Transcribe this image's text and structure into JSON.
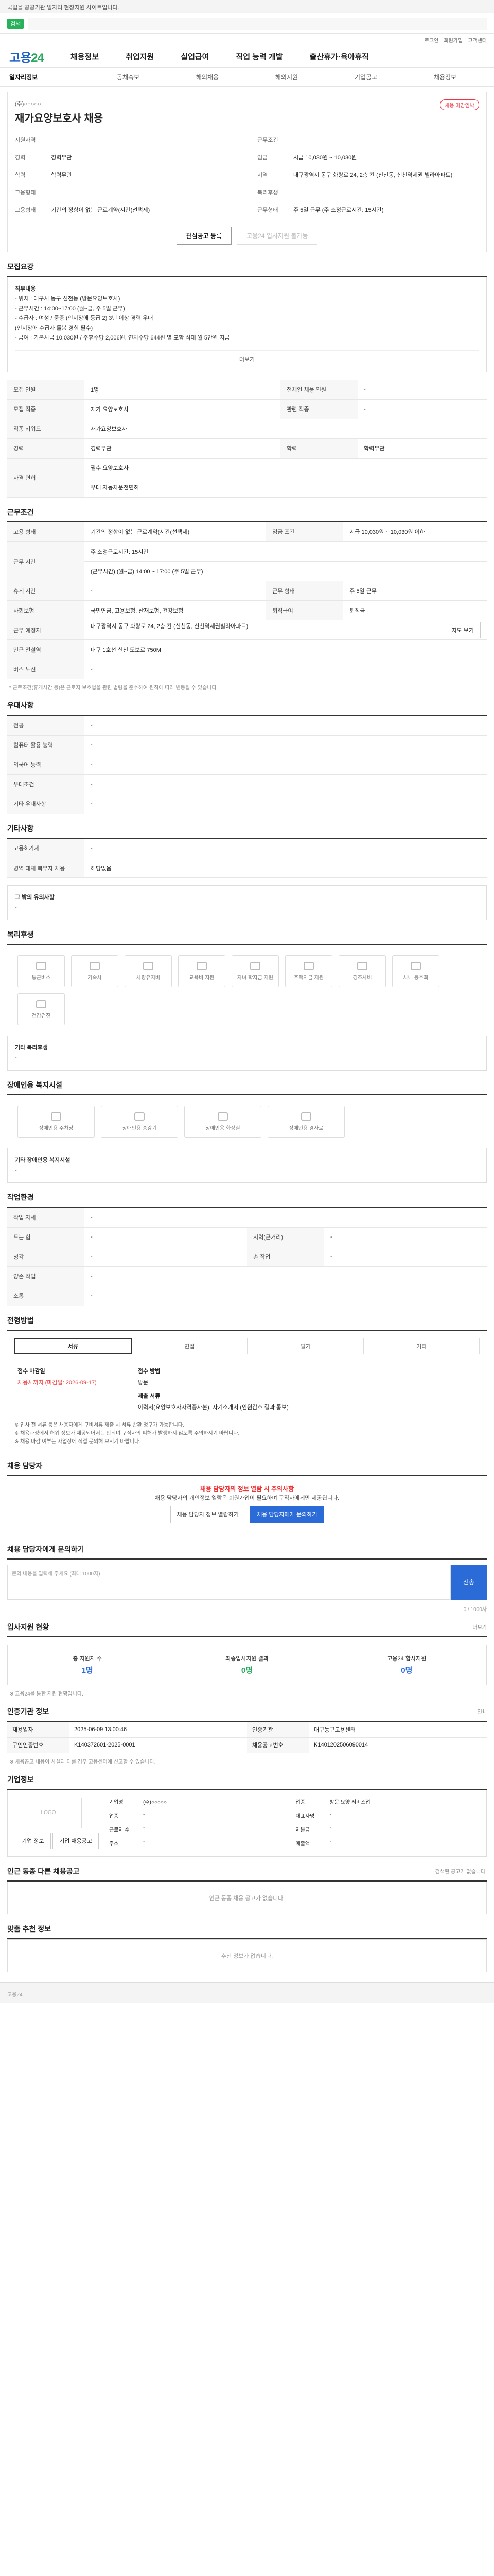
{
  "top": {
    "notice": "국립을 공공기관 일자리 현장지원 사이트입니다."
  },
  "search": {
    "badge": "검색",
    "placeholder": ""
  },
  "util": [
    "로그인",
    "회원가입",
    "고객센터"
  ],
  "gnb": {
    "logo_main": "고용",
    "logo_sub": "24",
    "menus": [
      "채용정보",
      "취업지원",
      "실업급여",
      "직업 능력 개발",
      "출산휴가·육아휴직"
    ]
  },
  "lnb": [
    "일자리정보",
    "공채속보",
    "해외채용",
    "해외지원",
    "기업공고",
    "채용정보"
  ],
  "job": {
    "company": "(주)○○○○○",
    "title": "재가요양보호사 채용",
    "status": "채용 마감임박",
    "summary": [
      {
        "k": "지원자격",
        "v": ""
      },
      {
        "k": "경력",
        "v": "경력무관"
      },
      {
        "k": "학력",
        "v": "학력무관"
      },
      {
        "k": "근무조건",
        "v": ""
      },
      {
        "k": "임금",
        "v": "시급 10,030원 ~ 10,030원"
      },
      {
        "k": "지역",
        "v": "대구광역시 동구 화랑로 24, 2층 칸 (신천동, 신천역세권 빌라아파트)"
      },
      {
        "k": "고용형태",
        "v": ""
      },
      {
        "k": "복리후생",
        "v": ""
      },
      {
        "k": "고용형태",
        "v": "기간의 정함이 없는 근로계약(시간(선택제)"
      },
      {
        "k": "근무형태",
        "v": "주 5일 근무 (주 소정근로시간: 15시간)"
      }
    ],
    "btn_scrap": "관심공고 등록",
    "btn_apply": "고용24 입사지원 불가능"
  },
  "recruit": {
    "heading": "모집요강",
    "lines": [
      "직무내용",
      "- 위치 : 대구시 동구 신천동 (방문요양보호사)",
      "- 근무시간 : 14:00~17:00 (월~금, 주 5일 근무)",
      "- 수급자 : 여성 / 중증 (인지장애 등급 2) 3년 이상 경력 우대",
      "  (인지장애 수급자 돌봄 경험 필수)",
      "- 급여 : 기본시급 10,030원 / 주휴수당 2,006원, 연차수당 644원 별 포함 식대 월 5만원 지급"
    ],
    "more": "더보기",
    "table": [
      [
        "모집 인원",
        "1명",
        "전체인 채용 인원",
        "-"
      ],
      [
        "모집 직종",
        "재가 요양보호사",
        "관련 직종",
        "-"
      ],
      [
        "직종 키워드",
        "재가요양보호사",
        "",
        ""
      ],
      [
        "경력",
        "경력무관",
        "학력",
        "학력무관"
      ],
      [
        "자격 면허",
        "필수 요양보호사",
        "",
        ""
      ],
      [
        "우대",
        "우대 자동차운전면허",
        "",
        ""
      ]
    ]
  },
  "work": {
    "heading": "근무조건",
    "rows": [
      [
        "고용 형태",
        "기간의 정함이 없는 근로계약(시간(선택제)",
        "임금 조건",
        "시급 10,030원 ~ 10,030원 이하"
      ],
      [
        "근무 시간",
        "주 소정근로시간: 15시간",
        "",
        ""
      ],
      [
        "",
        "(근무시간) (월~금) 14:00 ~ 17:00 (주 5일 근무)",
        "",
        ""
      ],
      [
        "휴게 시간",
        "-",
        "근무 형태",
        "주 5일 근무"
      ],
      [
        "사회보험",
        "국민연금, 고용보험, 산재보험, 건강보험",
        "퇴직급여",
        "퇴직금"
      ],
      [
        "근무 예정지",
        "대구광역시 동구 화랑로 24, 2층 칸 (신천동, 신천역세권빌라아파트)",
        "",
        ""
      ],
      [
        "인근 전철역",
        "대구 1호선 신천 도보로 750M",
        "",
        ""
      ],
      [
        "버스 노선",
        "-",
        "",
        ""
      ]
    ],
    "map_btn": "지도 보기",
    "note": "* 근로조건(휴게시간 등)은 근로자 보호법을 관련 법령을 준수하여 원칙에 따라 변동될 수 있습니다."
  },
  "benefit_extra": {
    "heading": "우대사항",
    "rows": [
      [
        "전공",
        "-"
      ],
      [
        "컴퓨터 활용 능력",
        "-"
      ],
      [
        "외국어 능력",
        "-"
      ],
      [
        "우대조건",
        "-"
      ],
      [
        "기타 우대사항",
        "-"
      ]
    ]
  },
  "etc": {
    "heading": "기타사항",
    "rows": [
      [
        "고용허가제",
        "-"
      ],
      [
        "병역 대체 복무자 채용",
        "해당없음"
      ]
    ],
    "other_heading": "그 밖의 유의사항",
    "other": "-"
  },
  "welfare": {
    "heading": "복리후생",
    "items": [
      "통근버스",
      "기숙사",
      "차량유지비",
      "교육비 지원",
      "자녀 학자금 지원",
      "주택자금 지원",
      "경조사비",
      "사내 동호회",
      "건강검진"
    ],
    "etc_heading": "기타 복리후생",
    "etc": "-"
  },
  "disabled": {
    "heading": "장애인용 복지시설",
    "items": [
      "장애인용 주차장",
      "장애인용 승강기",
      "장애인용 화장실",
      "장애인용 경사로"
    ],
    "etc_heading": "기타 장애인용 복지시설",
    "etc": "-"
  },
  "disability_cond": {
    "heading": "작업환경",
    "rows": [
      [
        "작업 자세",
        "-",
        "",
        ""
      ],
      [
        "드는 힘",
        "-",
        "시력(근거리)",
        "-"
      ],
      [
        "청각",
        "-",
        "손 작업",
        "-"
      ],
      [
        "양손 작업",
        "-",
        "",
        ""
      ],
      [
        "소통",
        "-",
        "",
        ""
      ]
    ]
  },
  "process": {
    "heading": "전형방법",
    "tabs": [
      "서류",
      "면접",
      "필기",
      "기타"
    ],
    "submit_k": "접수 마감일",
    "submit_v": "채용시까지 (마감일: 2026-09-17)",
    "method_k": "접수 방법",
    "method_v": "방문",
    "docs_k": "제출 서류",
    "docs_v": "이력서(요양보호사자격증사본), 자기소개서 (인원감소 결과 통보)"
  },
  "bullets": [
    "※ 입사 전 서류 등은 채용자에게 구비서류 제출 시 서류 반환 청구가 가능합니다.",
    "※ 채용과정에서 허위 정보가 제공되어서는 안되며 구직자의 피해가 발생하지 않도록 주의하시기 바랍니다.",
    "※ 채용 마감 여부는 사업장에 직접 문의해 보시기 바랍니다."
  ],
  "contact": {
    "heading": "채용 담당자",
    "warn_h": "채용 담당자의 정보 열람 시 주의사항",
    "warn_t": "채용 담당자의 개인정보 열람은 회원가입이 필요하며 구직자에게만 제공됩니다.",
    "btn1": "채용 담당자 정보 열람하기",
    "btn2": "채용 담당자에게 문의하기"
  },
  "qna": {
    "heading": "채용 담당자에게 문의하기",
    "placeholder": "문의 내용을 입력해 주세요 (최대 1000자)",
    "btn": "전송",
    "counter": "0 / 1000자"
  },
  "applicants": {
    "heading": "입사지원 현황",
    "link": "더보기",
    "stats": [
      {
        "k": "총 지원자 수",
        "v": "1명"
      },
      {
        "k": "최종입사지원 결과",
        "v": "0명"
      },
      {
        "k": "고용24 합사지원",
        "v": "0명"
      }
    ],
    "note": "※ 고용24를 통한 지원 현황입니다."
  },
  "meta": {
    "heading": "인증기관 정보",
    "print": "인쇄",
    "rows": [
      [
        "채용일자",
        "2025-06-09 13:00:46",
        "인증기관",
        "대구동구고용센터"
      ],
      [
        "구인인증번호",
        "K140372601-2025-0001",
        "채용공고번호",
        "K1401202506090014"
      ]
    ],
    "note": "※ 채용공고 내용이 사실과 다를 경우 고용센터에 신고할 수 있습니다."
  },
  "corp": {
    "heading": "기업정보",
    "logo": "LOGO",
    "grid": [
      [
        "기업명",
        "(주)○○○○○",
        "업종",
        "방문 요양 서비스업"
      ],
      [
        "업종",
        "-",
        "대표자명",
        "-"
      ],
      [
        "근로자 수",
        "-",
        "자본금",
        "-"
      ],
      [
        "주소",
        "-",
        "매출액",
        "-"
      ]
    ],
    "b1": "기업 정보",
    "b2": "기업 채용공고"
  },
  "same": {
    "heading": "인근 동종 다른 채용공고",
    "sub": "검색된 공고가 없습니다.",
    "empty": "인근 동종 채용 공고가 없습니다."
  },
  "recommend": {
    "heading": "맞춤 추천 정보",
    "empty": "추천 정보가 없습니다."
  },
  "footer": "고용24"
}
